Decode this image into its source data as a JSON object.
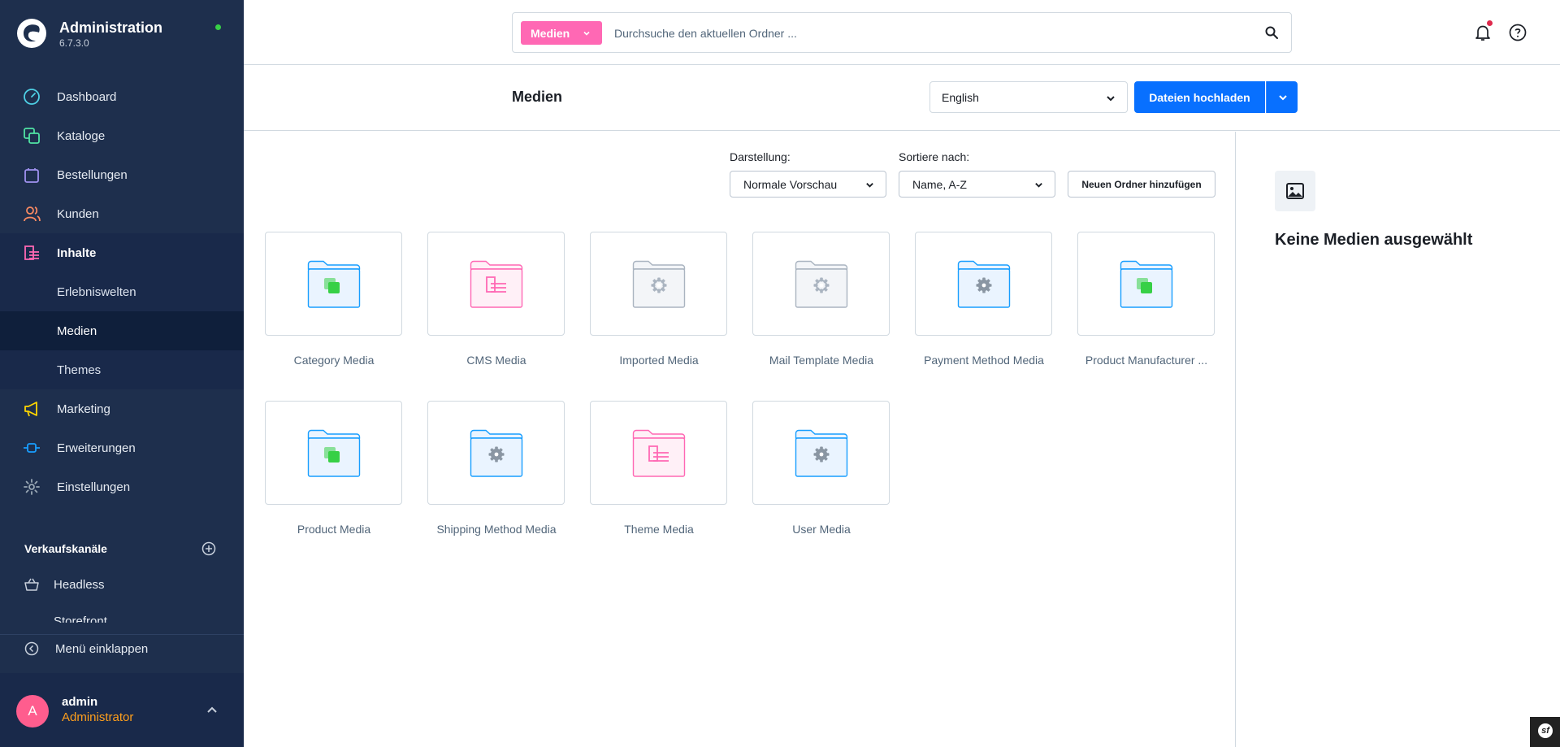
{
  "app": {
    "title": "Administration",
    "version": "6.7.3.0"
  },
  "sidebar": {
    "items": [
      {
        "label": "Dashboard",
        "icon": "gauge-icon",
        "color": "#4fd1e6"
      },
      {
        "label": "Kataloge",
        "icon": "catalog-icon",
        "color": "#50e3a4"
      },
      {
        "label": "Bestellungen",
        "icon": "shopping-bag-icon",
        "color": "#a092f0"
      },
      {
        "label": "Kunden",
        "icon": "users-icon",
        "color": "#f88962"
      },
      {
        "label": "Inhalte",
        "icon": "content-icon",
        "color": "#ff68b4"
      },
      {
        "label": "Marketing",
        "icon": "megaphone-icon",
        "color": "#ffd700"
      },
      {
        "label": "Erweiterungen",
        "icon": "plug-icon",
        "color": "#189eff"
      },
      {
        "label": "Einstellungen",
        "icon": "gear-icon",
        "color": "#9aa8b5"
      }
    ],
    "content_subitems": [
      {
        "label": "Erlebniswelten"
      },
      {
        "label": "Medien"
      },
      {
        "label": "Themes"
      }
    ],
    "sales_channels_title": "Verkaufskanäle",
    "sales_channels": [
      {
        "label": "Headless"
      },
      {
        "label": "Storefront"
      }
    ],
    "collapse_label": "Menü einklappen",
    "user": {
      "initial": "A",
      "name": "admin",
      "role": "Administrator"
    }
  },
  "search": {
    "type_label": "Medien",
    "placeholder": "Durchsuche den aktuellen Ordner ..."
  },
  "header": {
    "title": "Medien",
    "language": "English",
    "upload_label": "Dateien hochladen"
  },
  "controls": {
    "view_label": "Darstellung:",
    "view_value": "Normale Vorschau",
    "sort_label": "Sortiere nach:",
    "sort_value": "Name, A-Z",
    "add_folder_label": "Neuen Ordner hinzufügen"
  },
  "folders": [
    {
      "name": "Category Media",
      "theme": "blue",
      "icon": "catalog-icon"
    },
    {
      "name": "CMS Media",
      "theme": "pink",
      "icon": "content-icon"
    },
    {
      "name": "Imported Media",
      "theme": "grey",
      "icon": "gear-icon"
    },
    {
      "name": "Mail Template Media",
      "theme": "grey",
      "icon": "gear-icon"
    },
    {
      "name": "Payment Method Media",
      "theme": "blue",
      "icon": "gear-icon"
    },
    {
      "name": "Product Manufacturer ...",
      "theme": "blue",
      "icon": "catalog-icon"
    },
    {
      "name": "Product Media",
      "theme": "blue",
      "icon": "catalog-icon"
    },
    {
      "name": "Shipping Method Media",
      "theme": "blue",
      "icon": "gear-icon"
    },
    {
      "name": "Theme Media",
      "theme": "pink",
      "icon": "content-icon"
    },
    {
      "name": "User Media",
      "theme": "blue",
      "icon": "gear-icon"
    }
  ],
  "side_panel": {
    "title": "Keine Medien ausgewählt"
  },
  "colors": {
    "sidebar_bg": "#1e2f4d",
    "primary": "#0870ff",
    "media_pink": "#ff68b4",
    "online": "#37d046"
  }
}
